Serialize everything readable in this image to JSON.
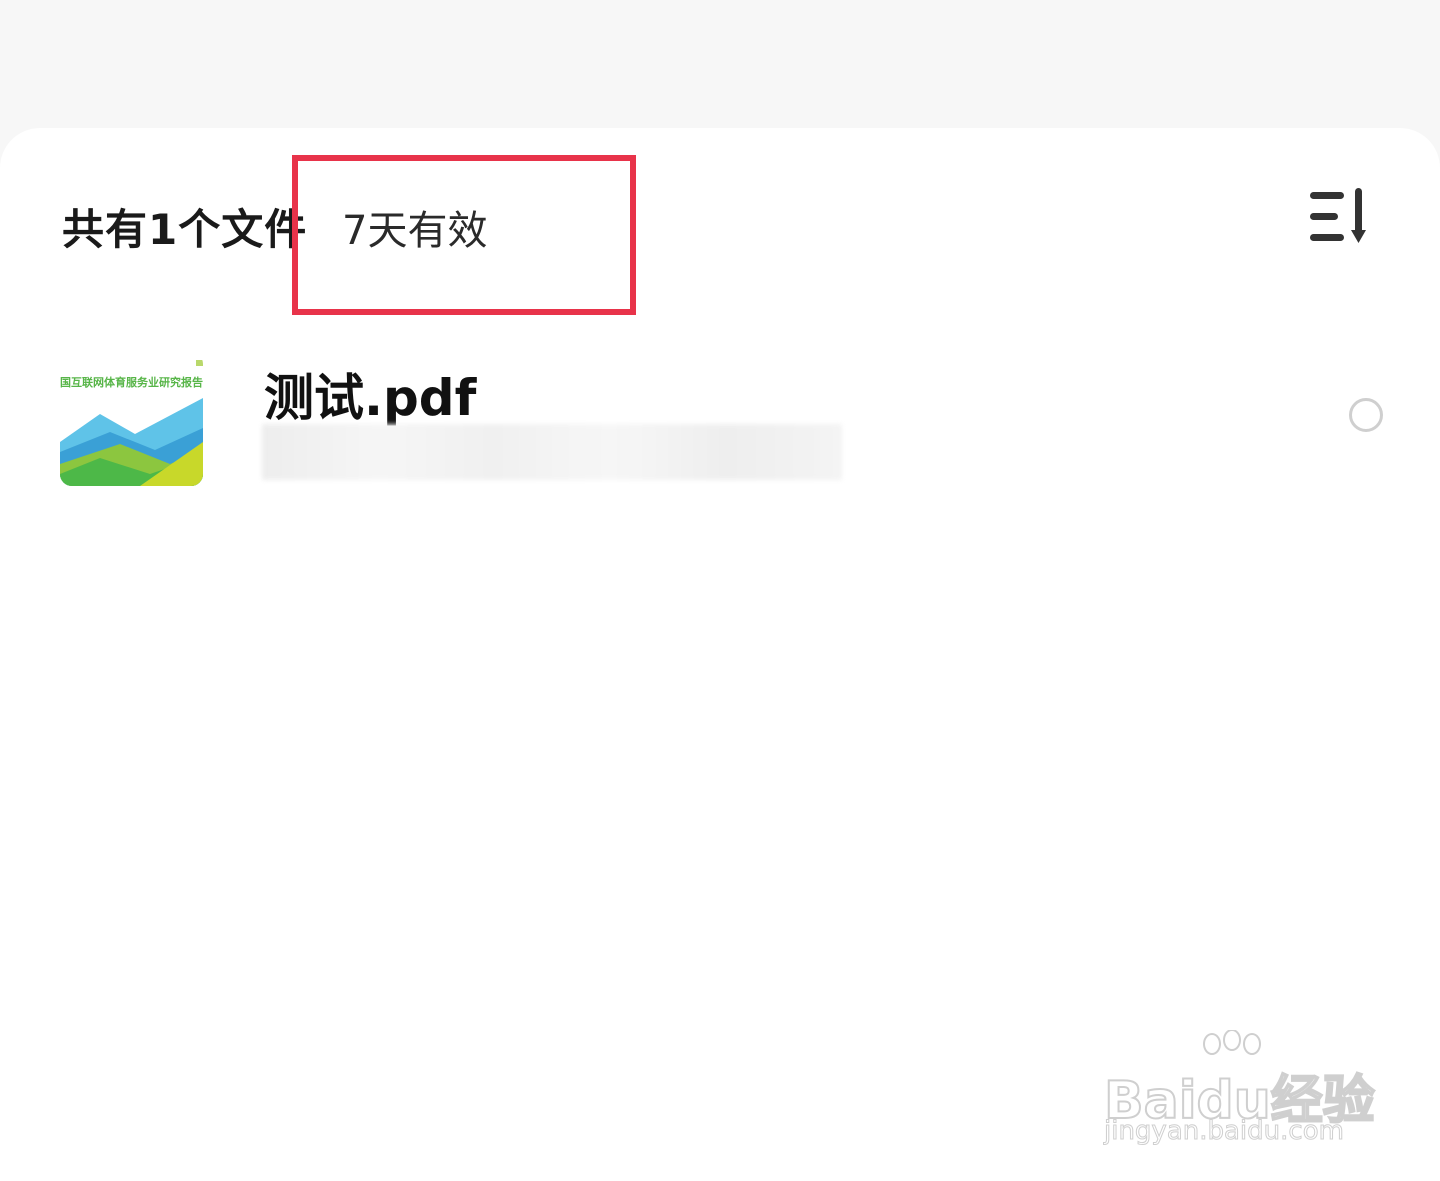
{
  "header": {
    "file_count": "共有1个文件",
    "validity": "7天有效",
    "sort_icon": "sort-descending-icon"
  },
  "highlight": {
    "color": "#e8334a"
  },
  "files": [
    {
      "name": "测试.pdf",
      "thumbnail_title": "国互联网体育服务业研究报告",
      "meta": "",
      "selected": false
    }
  ],
  "watermark": {
    "brand": "Baidu经验",
    "url": "jingyan.baidu.com"
  }
}
